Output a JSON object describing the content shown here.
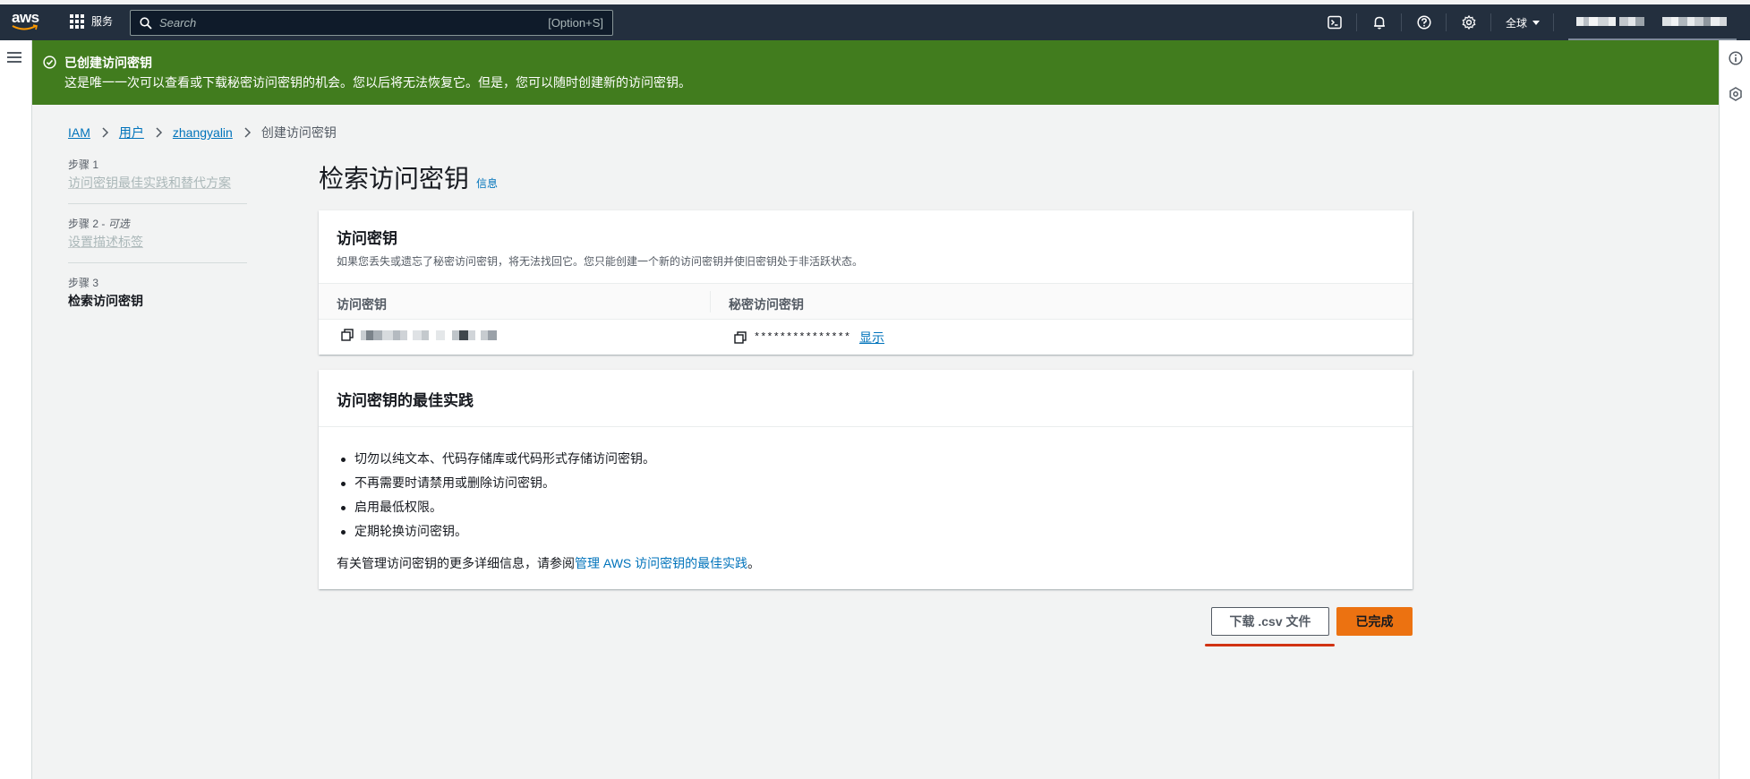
{
  "topnav": {
    "logo_text": "aws",
    "services_label": "服务",
    "search_placeholder": "Search",
    "search_shortcut": "[Option+S]",
    "region_label": "全球",
    "icons": [
      "cloudshell-icon",
      "bell-icon",
      "help-icon",
      "settings-icon"
    ]
  },
  "flash": {
    "title": "已创建访问密钥",
    "message": "这是唯一一次可以查看或下载秘密访问密钥的机会。您以后将无法恢复它。但是，您可以随时创建新的访问密钥。",
    "color": "#417c1e"
  },
  "breadcrumb": {
    "items": [
      "IAM",
      "用户",
      "zhangyalin"
    ],
    "current": "创建访问密钥"
  },
  "steps": [
    {
      "num": "步骤 1",
      "optional": "",
      "name": "访问密钥最佳实践和替代方案"
    },
    {
      "num": "步骤 2 -",
      "optional": "可选",
      "name": "设置描述标签"
    },
    {
      "num": "步骤 3",
      "optional": "",
      "name": "检索访问密钥"
    }
  ],
  "main": {
    "title": "检索访问密钥",
    "info_link": "信息"
  },
  "keys_card": {
    "title": "访问密钥",
    "description": "如果您丢失或遗忘了秘密访问密钥，将无法找回它。您只能创建一个新的访问密钥并使旧密钥处于非活跃状态。",
    "col_access_key": "访问密钥",
    "col_secret_key": "秘密访问密钥",
    "secret_masked": "***************",
    "show_label": "显示"
  },
  "best_practices": {
    "title": "访问密钥的最佳实践",
    "items": [
      "切勿以纯文本、代码存储库或代码形式存储访问密钥。",
      "不再需要时请禁用或删除访问密钥。",
      "启用最低权限。",
      "定期轮换访问密钥。"
    ],
    "more_prefix": "有关管理访问密钥的更多详细信息，请参阅",
    "more_link": "管理 AWS 访问密钥的最佳实践",
    "more_suffix": "。"
  },
  "actions": {
    "download_csv": "下载 .csv 文件",
    "done": "已完成",
    "primary_color": "#ec7211"
  }
}
